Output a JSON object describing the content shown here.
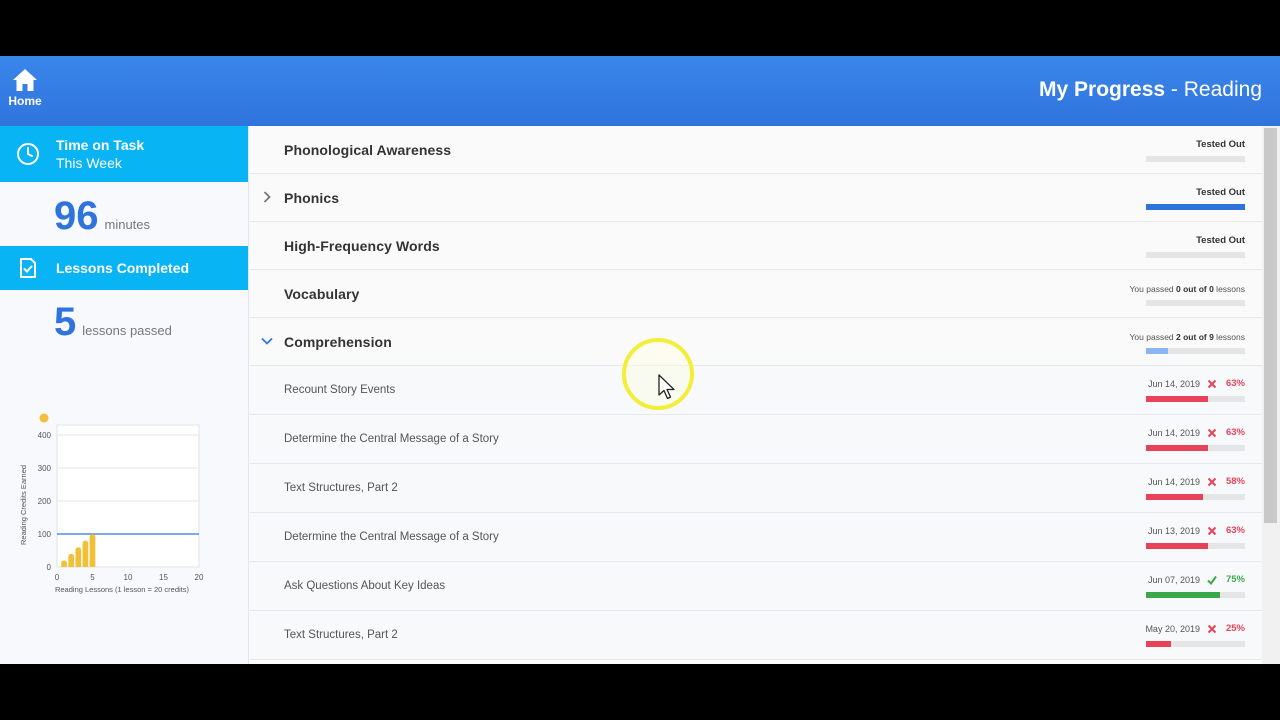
{
  "header": {
    "home_label": "Home",
    "title_main": "My Progress",
    "title_sep": " - ",
    "title_sub": "Reading"
  },
  "sidebar": {
    "time_head": "Time on Task",
    "time_sub": "This Week",
    "time_value": "96",
    "time_unit": "minutes",
    "lessons_head": "Lessons Completed",
    "lessons_value": "5",
    "lessons_unit": "lessons passed"
  },
  "chart_data": {
    "type": "bar",
    "ylabel": "Reading Credits Earned",
    "xlabel": "Reading Lessons (1 lesson = 20 credits)",
    "x_ticks": [
      "0",
      "5",
      "10",
      "15",
      "20"
    ],
    "y_ticks": [
      "0",
      "100",
      "200",
      "300",
      "400"
    ],
    "xlim": [
      0,
      20
    ],
    "ylim": [
      0,
      400
    ],
    "goal_line": 100,
    "x": [
      1,
      2,
      3,
      4,
      5
    ],
    "values": [
      20,
      40,
      60,
      80,
      100
    ],
    "bar_color": "#f2c037",
    "goal_color": "#2f74dd"
  },
  "categories": [
    {
      "name": "Phonological Awareness",
      "status": "Tested Out",
      "fill": 0,
      "color": "#2f74dd",
      "chevron": "none"
    },
    {
      "name": "Phonics",
      "status": "Tested Out",
      "fill": 1,
      "color": "#2f74dd",
      "chevron": "right"
    },
    {
      "name": "High-Frequency Words",
      "status": "Tested Out",
      "fill": 0,
      "color": "#2f74dd",
      "chevron": "none"
    },
    {
      "name": "Vocabulary",
      "status_pre": "You passed ",
      "status_bold": "0 out of 0",
      "status_post": " lessons",
      "fill": 0,
      "color": "#8ab4f2",
      "chevron": "none"
    },
    {
      "name": "Comprehension",
      "status_pre": "You passed ",
      "status_bold": "2 out of 9",
      "status_post": " lessons",
      "fill": 0.22,
      "color": "#8ab4f2",
      "chevron": "down"
    }
  ],
  "lessons": [
    {
      "name": "Recount Story Events",
      "date": "Jun 14, 2019",
      "mark": "x",
      "pct": "63%",
      "fill": 0.63
    },
    {
      "name": "Determine the Central Message of a Story",
      "date": "Jun 14, 2019",
      "mark": "x",
      "pct": "63%",
      "fill": 0.63
    },
    {
      "name": "Text Structures, Part 2",
      "date": "Jun 14, 2019",
      "mark": "x",
      "pct": "58%",
      "fill": 0.58
    },
    {
      "name": "Determine the Central Message of a Story",
      "date": "Jun 13, 2019",
      "mark": "x",
      "pct": "63%",
      "fill": 0.63
    },
    {
      "name": "Ask Questions About Key Ideas",
      "date": "Jun 07, 2019",
      "mark": "check",
      "pct": "75%",
      "fill": 0.75
    },
    {
      "name": "Text Structures, Part 2",
      "date": "May 20, 2019",
      "mark": "x",
      "pct": "25%",
      "fill": 0.25
    }
  ],
  "colors": {
    "fail": "#e8425a",
    "pass": "#3aa94a"
  }
}
